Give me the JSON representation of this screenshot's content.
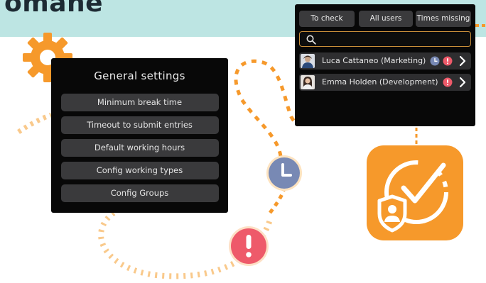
{
  "page": {
    "title": "omane",
    "accent_color": "#f6992b",
    "alert_color": "#ee5a6a",
    "clock_color": "#7889b4"
  },
  "settings": {
    "title": "General settings",
    "items": [
      {
        "label": "Minimum break time"
      },
      {
        "label": "Timeout to submit entries"
      },
      {
        "label": "Default working hours"
      },
      {
        "label": "Config working types"
      },
      {
        "label": "Config Groups"
      }
    ]
  },
  "users_panel": {
    "tabs": [
      {
        "label": "To check"
      },
      {
        "label": "All users"
      },
      {
        "label": "Times missing"
      }
    ],
    "search": {
      "placeholder": "",
      "value": ""
    },
    "users": [
      {
        "name": "Luca Cattaneo (Marketing)",
        "icons": [
          "clock-icon",
          "alert-icon"
        ]
      },
      {
        "name": "Emma Holden (Development)",
        "icons": [
          "alert-icon"
        ]
      }
    ]
  },
  "decorations": {
    "icons": [
      "gear-icon",
      "clock-icon",
      "alert-icon",
      "app-clock-shield-icon"
    ]
  }
}
